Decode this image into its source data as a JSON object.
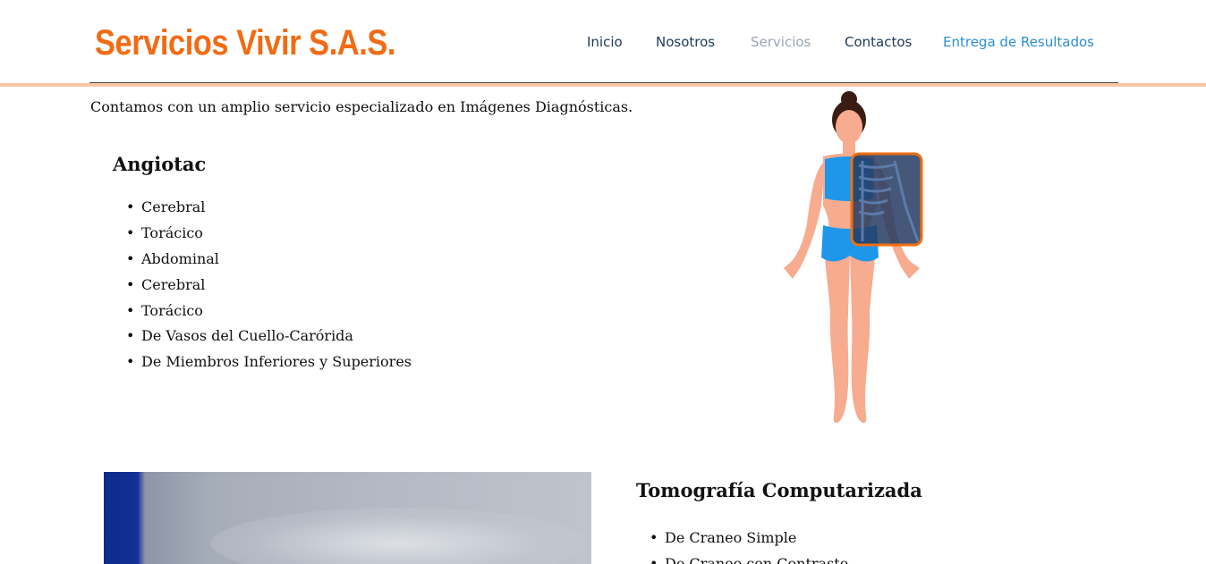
{
  "header": {
    "brand": "Servicios Vivir S.A.S.",
    "nav": [
      {
        "label": "Inicio"
      },
      {
        "label": "Nosotros"
      },
      {
        "label": "Servicios"
      },
      {
        "label": "Contactos"
      },
      {
        "label": "Entrega de Resultados"
      }
    ]
  },
  "main": {
    "intro": "Contamos con un amplio servicio especializado en Imágenes Diagnósticas.",
    "angiotac": {
      "title": "Angiotac",
      "items": [
        "Cerebral",
        "Torácico",
        "Abdominal",
        "Cerebral",
        "Torácico",
        "De Vasos del Cuello-Carórida",
        "De Miembros Inferiores y Superiores"
      ]
    },
    "tomografia": {
      "title": "Tomografía Computarizada",
      "items": [
        "De Craneo Simple",
        "De Craneo con Contraste"
      ]
    }
  },
  "colors": {
    "brand": "#f26b14",
    "nav_active": "#9aa6b4",
    "nav_highlight": "#2b8fd6",
    "header_rule": "#f9c6a4"
  }
}
